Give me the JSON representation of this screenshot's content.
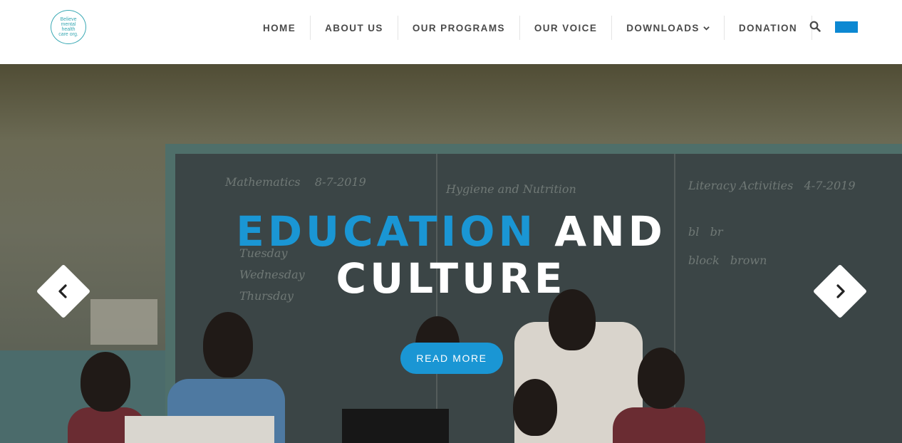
{
  "logo": {
    "text": "Believe mental health care org."
  },
  "nav": {
    "items": [
      "HOME",
      "ABOUT US",
      "OUR PROGRAMS",
      "OUR VOICE",
      "DOWNLOADS",
      "DONATION"
    ],
    "downloads_caret": "chevron-down-icon",
    "search_icon": "search-icon"
  },
  "language_flag_color": "#0c88d2",
  "slide": {
    "title_accent": "EDUCATION",
    "title_rest_1": "AND",
    "title_line_2": "CULTURE",
    "button_label": "READ MORE",
    "prev_icon": "chevron-left-icon",
    "next_icon": "chevron-right-icon"
  },
  "colors": {
    "accent": "#1a96d4",
    "nav_text": "#4a4a4a"
  }
}
